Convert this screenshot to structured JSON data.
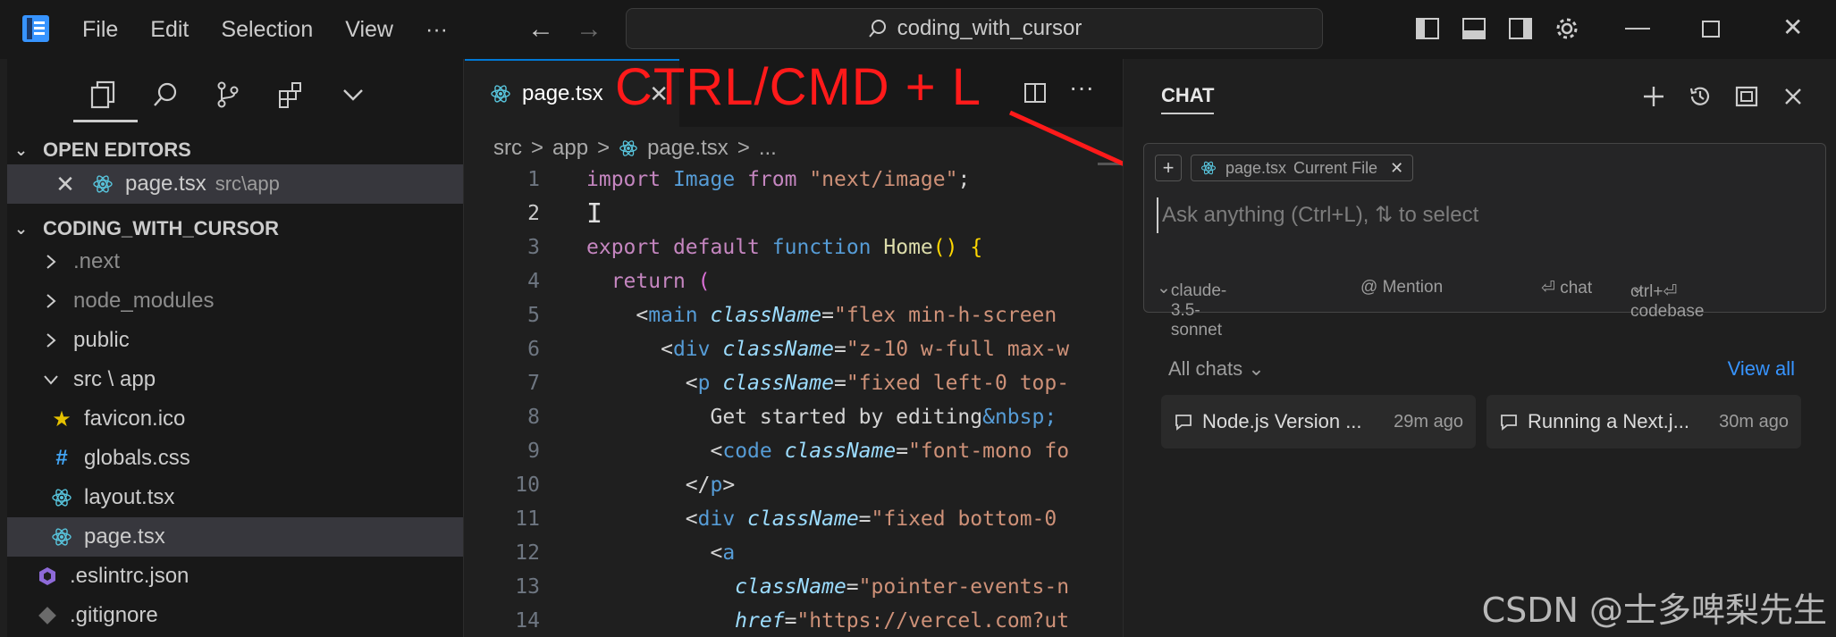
{
  "window": {
    "search_text": "coding_with_cursor",
    "menu": [
      "File",
      "Edit",
      "Selection",
      "View",
      "···"
    ]
  },
  "sidebar": {
    "open_editors_label": "OPEN EDITORS",
    "open_editor": {
      "name": "page.tsx",
      "path": "src\\app"
    },
    "project_label": "CODING_WITH_CURSOR",
    "items": [
      {
        "label": ".next",
        "type": "folder-collapsed",
        "muted": true
      },
      {
        "label": "node_modules",
        "type": "folder-collapsed",
        "muted": true
      },
      {
        "label": "public",
        "type": "folder-collapsed",
        "muted": false
      },
      {
        "label": "src \\ app",
        "type": "folder-open",
        "muted": false
      },
      {
        "label": "favicon.ico",
        "type": "star-icon",
        "muted": false
      },
      {
        "label": "globals.css",
        "type": "hash-icon",
        "muted": false
      },
      {
        "label": "layout.tsx",
        "type": "react-icon",
        "muted": false
      },
      {
        "label": "page.tsx",
        "type": "react-icon",
        "muted": false,
        "selected": true
      },
      {
        "label": ".eslintrc.json",
        "type": "eslint-icon",
        "muted": false
      },
      {
        "label": ".gitignore",
        "type": "git-icon",
        "muted": false
      }
    ]
  },
  "editor": {
    "tab_label": "page.tsx",
    "breadcrumb": [
      "src",
      ">",
      "app",
      ">",
      "page.tsx",
      ">",
      "..."
    ],
    "overlay_text": "CTRL/CMD + L",
    "line_numbers": [
      "1",
      "2",
      "3",
      "4",
      "5",
      "6",
      "7",
      "8",
      "9",
      "10",
      "11",
      "12",
      "13",
      "14"
    ]
  },
  "chat": {
    "title": "CHAT",
    "file_chip": "page.tsx",
    "file_chip_note": "Current File",
    "input_placeholder": "Ask anything (Ctrl+L), ⇅ to select",
    "model": "claude-3.5-sonnet",
    "mention": "@ Mention",
    "chat_hint": "⏎ chat",
    "codebase_hint": "ctrl+⏎ codebase",
    "all_chats": "All chats",
    "view_all": "View all",
    "recent": [
      {
        "title": "Node.js Version ...",
        "ago": "29m ago"
      },
      {
        "title": "Running a Next.j...",
        "ago": "30m ago"
      }
    ]
  },
  "watermark": "CSDN @士多啤梨先生",
  "colors": {
    "accent": "#0078d4",
    "overlay": "#ff1a1a",
    "link": "#3794ff"
  }
}
